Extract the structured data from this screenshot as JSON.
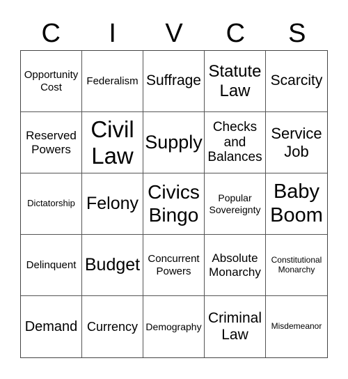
{
  "title_letters": [
    "C",
    "I",
    "V",
    "C",
    "S"
  ],
  "cells": [
    {
      "text": "Opportunity\nCost",
      "size": 15
    },
    {
      "text": "Federalism",
      "size": 15
    },
    {
      "text": "Suffrage",
      "size": 21
    },
    {
      "text": "Statute\nLaw",
      "size": 24
    },
    {
      "text": "Scarcity",
      "size": 21
    },
    {
      "text": "Reserved\nPowers",
      "size": 17
    },
    {
      "text": "Civil\nLaw",
      "size": 33
    },
    {
      "text": "Supply",
      "size": 27
    },
    {
      "text": "Checks\nand\nBalances",
      "size": 19
    },
    {
      "text": "Service\nJob",
      "size": 22
    },
    {
      "text": "Dictatorship",
      "size": 13
    },
    {
      "text": "Felony",
      "size": 25
    },
    {
      "text": "Civics\nBingo",
      "size": 28
    },
    {
      "text": "Popular\nSovereignty",
      "size": 14
    },
    {
      "text": "Baby\nBoom",
      "size": 29
    },
    {
      "text": "Delinquent",
      "size": 15
    },
    {
      "text": "Budget",
      "size": 25
    },
    {
      "text": "Concurrent\nPowers",
      "size": 15
    },
    {
      "text": "Absolute\nMonarchy",
      "size": 17
    },
    {
      "text": "Constitutional\nMonarchy",
      "size": 12
    },
    {
      "text": "Demand",
      "size": 20
    },
    {
      "text": "Currency",
      "size": 18
    },
    {
      "text": "Demography",
      "size": 14
    },
    {
      "text": "Criminal\nLaw",
      "size": 21
    },
    {
      "text": "Misdemeanor",
      "size": 12
    }
  ]
}
